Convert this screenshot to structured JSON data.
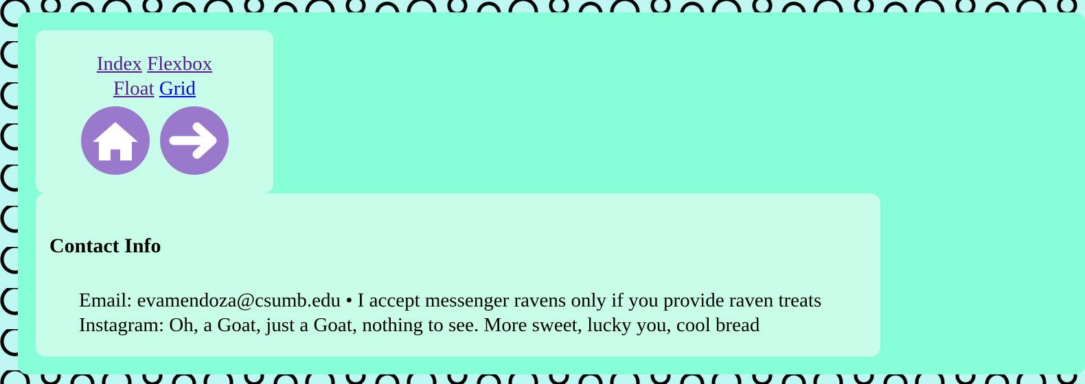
{
  "nav": {
    "links": [
      {
        "label": "Index"
      },
      {
        "label": "Flexbox"
      },
      {
        "label": "Float"
      },
      {
        "label": "Grid"
      }
    ],
    "icons": [
      "home-icon",
      "arrow-right-icon"
    ]
  },
  "contact": {
    "heading": "Contact Info",
    "items": [
      "Email: evamendoza@csumb.edu • I accept messenger ravens only if you provide raven treats",
      "Instagram: Oh, a Goat, just a Goat, nothing to see. More sweet, lucky you, cool bread"
    ]
  },
  "colors": {
    "page_bg": "#bff7f2",
    "frame_bg": "#86ffd8",
    "card_bg": "#c8fde9",
    "icon_bg": "#9a79cc",
    "visited_link": "#551a8b",
    "link": "#0000ee"
  }
}
